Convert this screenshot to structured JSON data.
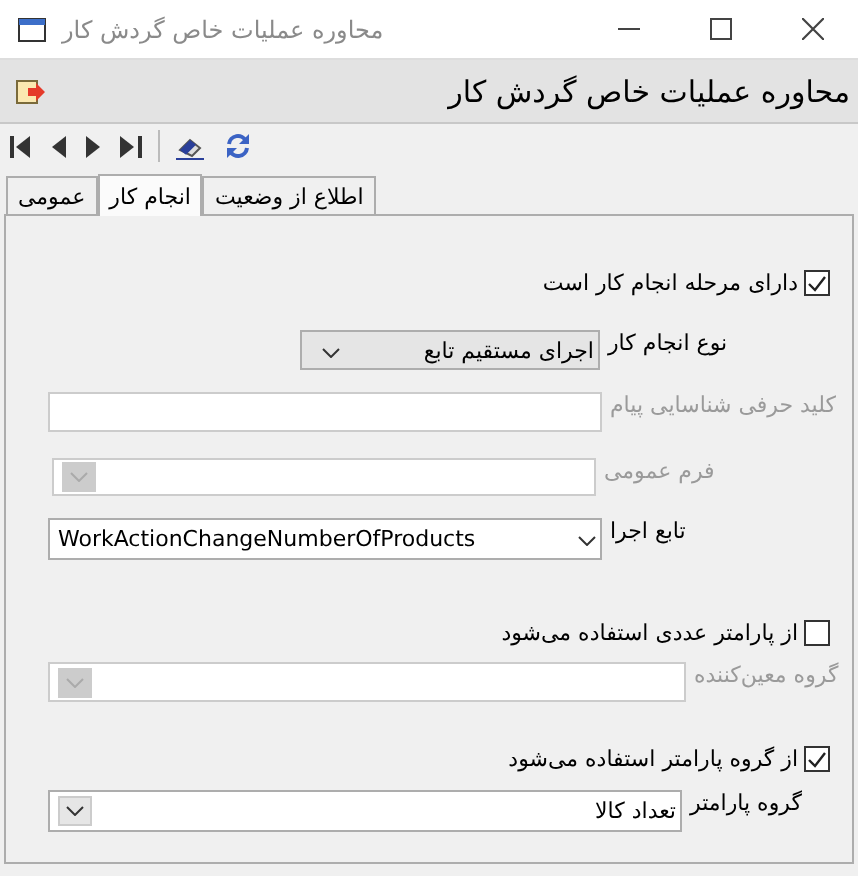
{
  "window": {
    "title": "محاوره عملیات خاص گردش کار"
  },
  "header": {
    "title": "محاوره عملیات خاص گردش کار"
  },
  "tabs": [
    {
      "label": "اطلاع از وضعیت",
      "selected": false
    },
    {
      "label": "انجام کار",
      "selected": true
    },
    {
      "label": "عمومی",
      "selected": false
    }
  ],
  "form": [
    {
      "kind": "checkbox",
      "label": "دارای مرحله انجام کار است",
      "checked": true
    },
    {
      "kind": "combo",
      "label": "نوع انجام کار",
      "value": "اجرای مستقیم تابع",
      "disabled": false
    },
    {
      "kind": "text",
      "label": "کلید حرفی شناسایی پیام",
      "disabled": true
    },
    {
      "kind": "combo",
      "label": "فرم عمومی",
      "disabled": true
    },
    {
      "kind": "combo",
      "label": "تابع اجرا",
      "value": "WorkActionChangeNumberOfProducts",
      "disabled": false
    },
    {
      "kind": "checkbox",
      "label": "از پارامتر عددی استفاده می‌شود",
      "checked": false
    },
    {
      "kind": "combo",
      "label": "گروه معین‌کننده",
      "disabled": true
    },
    {
      "kind": "checkbox",
      "label": "از گروه پارامتر استفاده می‌شود",
      "checked": true
    },
    {
      "kind": "combo",
      "label": "گروه پارامتر",
      "value": "تعداد کالا",
      "disabled": false
    }
  ]
}
